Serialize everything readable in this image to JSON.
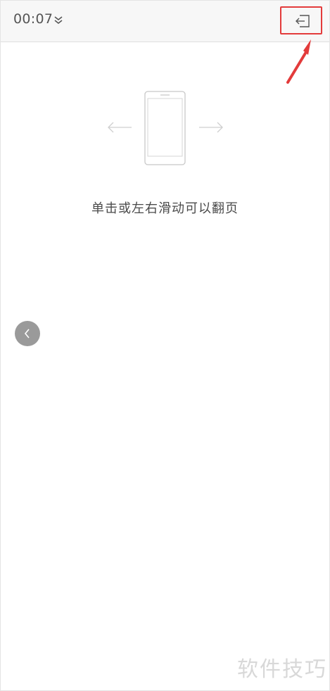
{
  "status": {
    "time": "00:07",
    "expand_icon": "double-chevron-down-icon"
  },
  "toolbar": {
    "exit_icon": "exit-reader-icon"
  },
  "hint": {
    "illustration_icon": "phone-swipe-icon",
    "text": "单击或左右滑动可以翻页"
  },
  "nav": {
    "prev_icon": "chevron-left-icon"
  },
  "watermark": {
    "text": "软件技巧"
  },
  "colors": {
    "annotation": "#e33b3b",
    "topbar_bg": "#f7f7f7",
    "prev_button_bg": "#9a9a9a"
  }
}
